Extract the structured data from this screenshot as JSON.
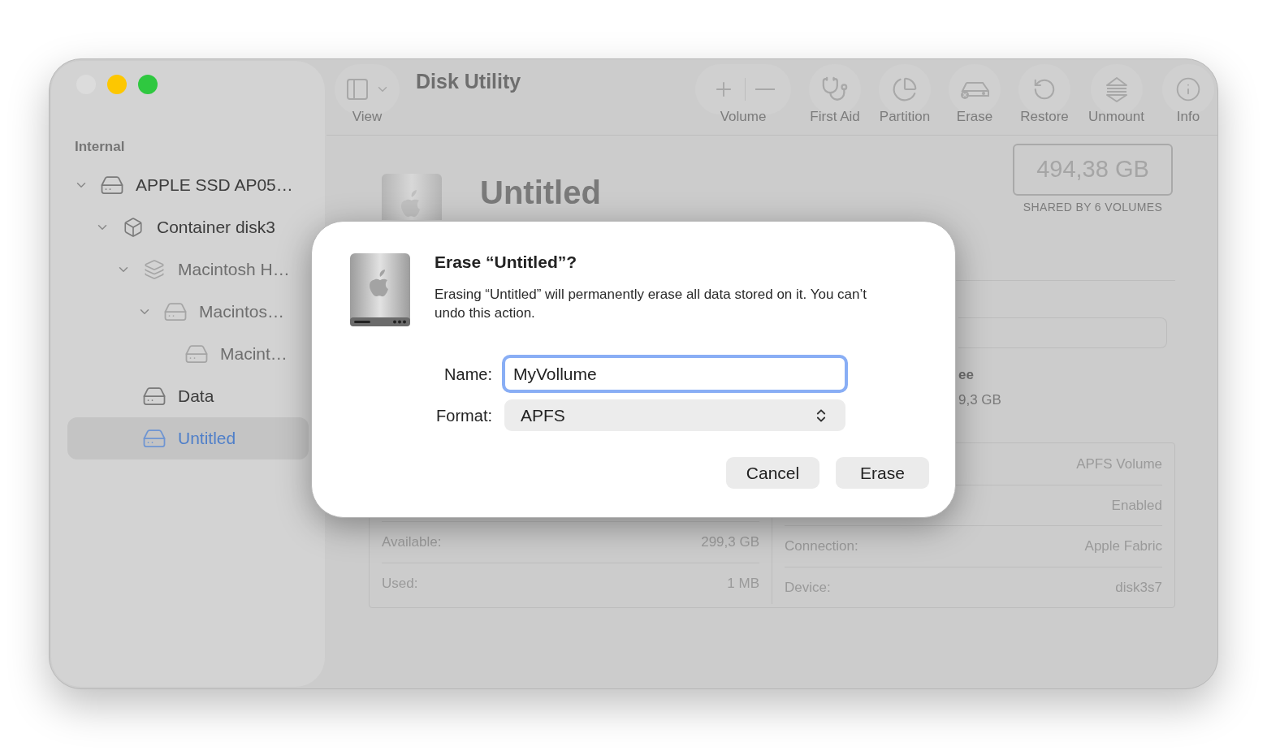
{
  "window": {
    "title": "Disk Utility"
  },
  "toolbar": {
    "view": {
      "label": "View"
    },
    "buttons": [
      {
        "kind": "volume",
        "label": "Volume"
      },
      {
        "kind": "first-aid",
        "label": "First Aid"
      },
      {
        "kind": "partition",
        "label": "Partition"
      },
      {
        "kind": "erase",
        "label": "Erase"
      },
      {
        "kind": "restore",
        "label": "Restore"
      },
      {
        "kind": "unmount",
        "label": "Unmount"
      },
      {
        "kind": "info",
        "label": "Info"
      }
    ]
  },
  "sidebar": {
    "section": "Internal",
    "items": [
      {
        "kind": "drive",
        "label": "APPLE SSD AP05…",
        "expanded": true,
        "dimmed": false,
        "selected": false,
        "children": [
          {
            "kind": "container",
            "label": "Container disk3",
            "expanded": true,
            "dimmed": false,
            "selected": false,
            "children": [
              {
                "kind": "layers",
                "label": "Macintosh H…",
                "expanded": true,
                "dimmed": true,
                "selected": false,
                "children": [
                  {
                    "kind": "drive",
                    "label": "Macintos…",
                    "expanded": true,
                    "dimmed": true,
                    "selected": false,
                    "children": [
                      {
                        "kind": "drive",
                        "label": "Macint…",
                        "dimmed": true,
                        "selected": false
                      }
                    ]
                  }
                ]
              },
              {
                "kind": "drive",
                "label": "Data",
                "dimmed": false,
                "selected": false
              },
              {
                "kind": "drive",
                "label": "Untitled",
                "dimmed": false,
                "selected": true
              }
            ]
          }
        ]
      }
    ]
  },
  "volume": {
    "name": "Untitled",
    "capacity": "494,38 GB",
    "capacity_caption": "SHARED BY 6 VOLUMES",
    "legend": {
      "label": "ee",
      "value": "9,3 GB"
    },
    "info_left": [
      {
        "label": "Available:",
        "value": "299,3 GB"
      },
      {
        "label": "Used:",
        "value": "1 MB"
      }
    ],
    "info_right": [
      {
        "value": "APFS Volume"
      },
      {
        "value": "Enabled"
      },
      {
        "label": "Connection:",
        "value": "Apple Fabric"
      },
      {
        "label": "Device:",
        "value": "disk3s7"
      }
    ]
  },
  "dialog": {
    "title": "Erase “Untitled”?",
    "message": "Erasing “Untitled” will permanently erase all data stored on it. You can’t undo this action.",
    "name_label": "Name:",
    "name_value": "MyVollume",
    "name_focused": true,
    "format_label": "Format:",
    "format_value": "APFS",
    "buttons": [
      "Cancel",
      "Erase"
    ]
  }
}
